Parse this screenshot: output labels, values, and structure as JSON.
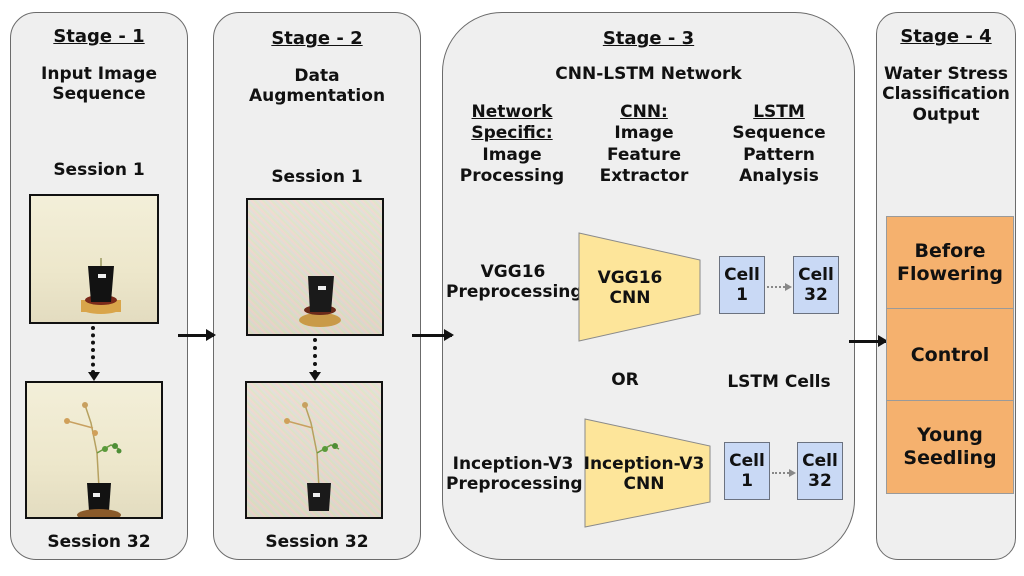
{
  "stages": [
    {
      "title": "Stage - 1",
      "subtitle_lines": [
        "Input Image",
        "Sequence"
      ],
      "session_top": "Session 1",
      "session_bottom": "Session 32"
    },
    {
      "title": "Stage - 2",
      "subtitle_lines": [
        "Data",
        "Augmentation"
      ],
      "session_top": "Session 1",
      "session_bottom": "Session 32"
    },
    {
      "title": "Stage - 3",
      "subtitle": "CNN-LSTM Network",
      "columns": [
        {
          "heading_lines": [
            "Network",
            "Specific:"
          ],
          "desc_lines": [
            "Image",
            "Processing"
          ]
        },
        {
          "heading_lines": [
            "CNN:"
          ],
          "desc_lines": [
            "Image",
            "Feature",
            "Extractor"
          ]
        },
        {
          "heading_lines": [
            "LSTM"
          ],
          "desc_lines": [
            "Sequence",
            "Pattern",
            "Analysis"
          ]
        }
      ],
      "branches": [
        {
          "preprocessing_lines": [
            "VGG16",
            "Preprocessing"
          ],
          "cnn_lines": [
            "VGG16",
            "CNN"
          ],
          "cell_first": [
            "Cell",
            "1"
          ],
          "cell_last": [
            "Cell",
            "32"
          ]
        },
        {
          "preprocessing_lines": [
            "Inception-V3",
            "Preprocessing"
          ],
          "cnn_lines": [
            "Inception-V3",
            "CNN"
          ],
          "cell_first": [
            "Cell",
            "1"
          ],
          "cell_last": [
            "Cell",
            "32"
          ]
        }
      ],
      "or_label": "OR",
      "lstm_cells_label": "LSTM Cells"
    },
    {
      "title": "Stage - 4",
      "subtitle_lines": [
        "Water Stress",
        "Classification",
        "Output"
      ],
      "classes": [
        {
          "lines": [
            "Before",
            "Flowering"
          ]
        },
        {
          "lines": [
            "Control"
          ]
        },
        {
          "lines": [
            "Young",
            "Seedling"
          ]
        }
      ]
    }
  ],
  "colors": {
    "panel": "#efefef",
    "cnn_trapezoid": "#fde59a",
    "lstm_cell": "#c9d9f5",
    "output_class": "#f5b16e"
  }
}
